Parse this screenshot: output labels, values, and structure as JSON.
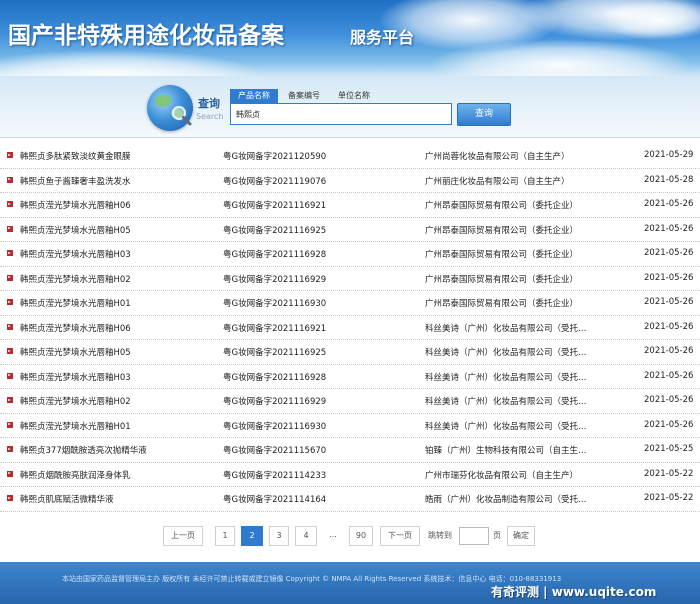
{
  "header": {
    "title": "国产非特殊用途化妆品备案",
    "subtitle": "服务平台"
  },
  "search": {
    "caption": "查询",
    "caption_en": "Search",
    "tabs": [
      {
        "label": "产品名称",
        "active": true
      },
      {
        "label": "备案编号",
        "active": false
      },
      {
        "label": "单位名称",
        "active": false
      }
    ],
    "query": "韩熙贞",
    "button_label": "查询"
  },
  "records": [
    {
      "name": "韩熙贞多肽紧致淡纹黄金眼膜",
      "reg": "粤G妆网备字2021120590",
      "company": "广州尚蓉化妆品有限公司（自主生产）",
      "date": "2021-05-29"
    },
    {
      "name": "韩熙贞鱼子酱臻奢丰盈洗发水",
      "reg": "粤G妆网备字2021119076",
      "company": "广州丽庄化妆品有限公司（自主生产）",
      "date": "2021-05-28"
    },
    {
      "name": "韩熙贞滢光梦境水光唇釉H06",
      "reg": "粤G妆网备字2021116921",
      "company": "广州昂泰国际贸易有限公司（委托企业）",
      "date": "2021-05-26"
    },
    {
      "name": "韩熙贞滢光梦境水光唇釉H05",
      "reg": "粤G妆网备字2021116925",
      "company": "广州昂泰国际贸易有限公司（委托企业）",
      "date": "2021-05-26"
    },
    {
      "name": "韩熙贞滢光梦境水光唇釉H03",
      "reg": "粤G妆网备字2021116928",
      "company": "广州昂泰国际贸易有限公司（委托企业）",
      "date": "2021-05-26"
    },
    {
      "name": "韩熙贞滢光梦境水光唇釉H02",
      "reg": "粤G妆网备字2021116929",
      "company": "广州昂泰国际贸易有限公司（委托企业）",
      "date": "2021-05-26"
    },
    {
      "name": "韩熙贞滢光梦境水光唇釉H01",
      "reg": "粤G妆网备字2021116930",
      "company": "广州昂泰国际贸易有限公司（委托企业）",
      "date": "2021-05-26"
    },
    {
      "name": "韩熙贞滢光梦境水光唇釉H06",
      "reg": "粤G妆网备字2021116921",
      "company": "科丝美诗（广州）化妆品有限公司（受托…",
      "date": "2021-05-26"
    },
    {
      "name": "韩熙贞滢光梦境水光唇釉H05",
      "reg": "粤G妆网备字2021116925",
      "company": "科丝美诗（广州）化妆品有限公司（受托…",
      "date": "2021-05-26"
    },
    {
      "name": "韩熙贞滢光梦境水光唇釉H03",
      "reg": "粤G妆网备字2021116928",
      "company": "科丝美诗（广州）化妆品有限公司（受托…",
      "date": "2021-05-26"
    },
    {
      "name": "韩熙贞滢光梦境水光唇釉H02",
      "reg": "粤G妆网备字2021116929",
      "company": "科丝美诗（广州）化妆品有限公司（受托…",
      "date": "2021-05-26"
    },
    {
      "name": "韩熙贞滢光梦境水光唇釉H01",
      "reg": "粤G妆网备字2021116930",
      "company": "科丝美诗（广州）化妆品有限公司（受托…",
      "date": "2021-05-26"
    },
    {
      "name": "韩熙贞377烟酰胺透亮次抛精华液",
      "reg": "粤G妆网备字2021115670",
      "company": "铂臻（广州）生物科技有限公司（自主生…",
      "date": "2021-05-25"
    },
    {
      "name": "韩熙贞烟酰胺亮肤润泽身体乳",
      "reg": "粤G妆网备字2021114233",
      "company": "广州市瑞芬化妆品有限公司（自主生产）",
      "date": "2021-05-22"
    },
    {
      "name": "韩熙贞肌底赋活微精华液",
      "reg": "粤G妆网备字2021114164",
      "company": "皓雨（广州）化妆品制造有限公司（受托…",
      "date": "2021-05-22"
    }
  ],
  "pagination": {
    "prev": "上一页",
    "pages": [
      "1",
      "2",
      "3",
      "4"
    ],
    "current": "2",
    "ellipsis": "...",
    "last": "90",
    "next": "下一页",
    "goto_prefix": "跳转到",
    "goto_suffix": "页",
    "confirm": "确定"
  },
  "footer": {
    "text": "本站由国家药品监督管理局主办 版权所有 未经许可禁止转载或建立镜像 Copyright © NMPA All Rights Reserved 系统技术：信息中心 电话：010-88331913",
    "watermark": "有奇评测 | www.uqite.com"
  },
  "colors": {
    "accent": "#2f7bd0",
    "bullet": "#c0282d",
    "footer": "#2766ad"
  }
}
